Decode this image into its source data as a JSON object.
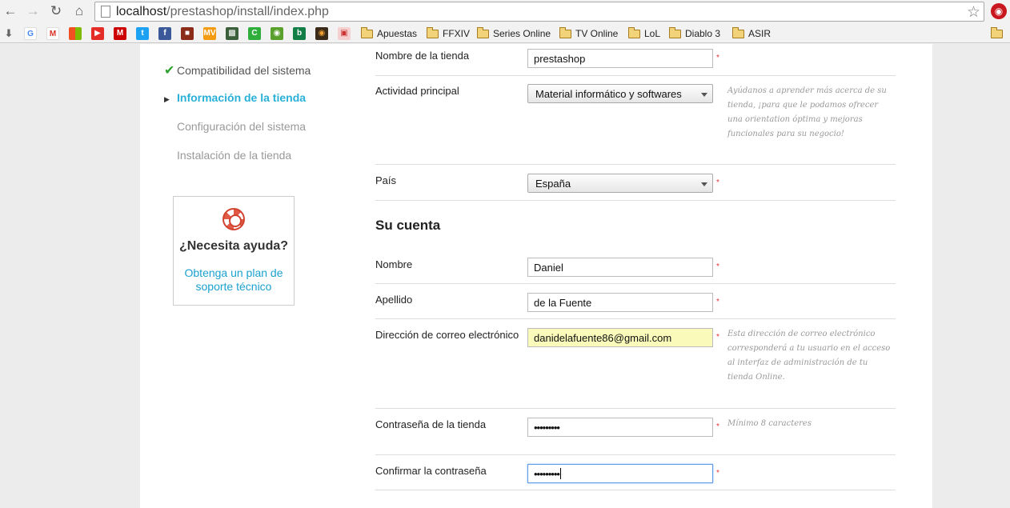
{
  "browser": {
    "url_host": "localhost",
    "url_path": "/prestashop/install/index.php",
    "bookmarks": [
      "Apuestas",
      "FFXIV",
      "Series Online",
      "TV Online",
      "LoL",
      "Diablo 3",
      "ASIR"
    ]
  },
  "steps": {
    "done": "Compatibilidad del sistema",
    "active": "Información de la tienda",
    "pending_1": "Configuración del sistema",
    "pending_2": "Instalación de la tienda"
  },
  "help": {
    "title": "¿Necesita ayuda?",
    "link": "Obtenga un plan de soporte técnico"
  },
  "form": {
    "store_name_label": "Nombre de la tienda",
    "store_name_value": "prestashop",
    "activity_label": "Actividad principal",
    "activity_value": "Material informático y softwares",
    "activity_hint": "Ayúdanos a aprender más acerca de su tienda, ¡para que le podamos ofrecer una orientation óptima y mejoras funcionales para su negocio!",
    "country_label": "País",
    "country_value": "España",
    "account_title": "Su cuenta",
    "first_name_label": "Nombre",
    "first_name_value": "Daniel",
    "last_name_label": "Apellido",
    "last_name_value": "de la Fuente",
    "email_label": "Dirección de correo electrónico",
    "email_value": "danidelafuente86@gmail.com",
    "email_hint": "Esta dirección de correo electrónico corresponderá a tu usuario en el acceso al interfaz de administración de tu tienda Online.",
    "password_label": "Contraseña de la tienda",
    "password_value": "•••••••••",
    "password_hint": "Mínimo 8 caracteres",
    "confirm_label": "Confirmar la contraseña",
    "confirm_value": "•••••••••",
    "required_mark": "*"
  },
  "colors": {
    "accent": "#29b0d8",
    "required": "#e03434",
    "autofill": "#fafaba"
  }
}
